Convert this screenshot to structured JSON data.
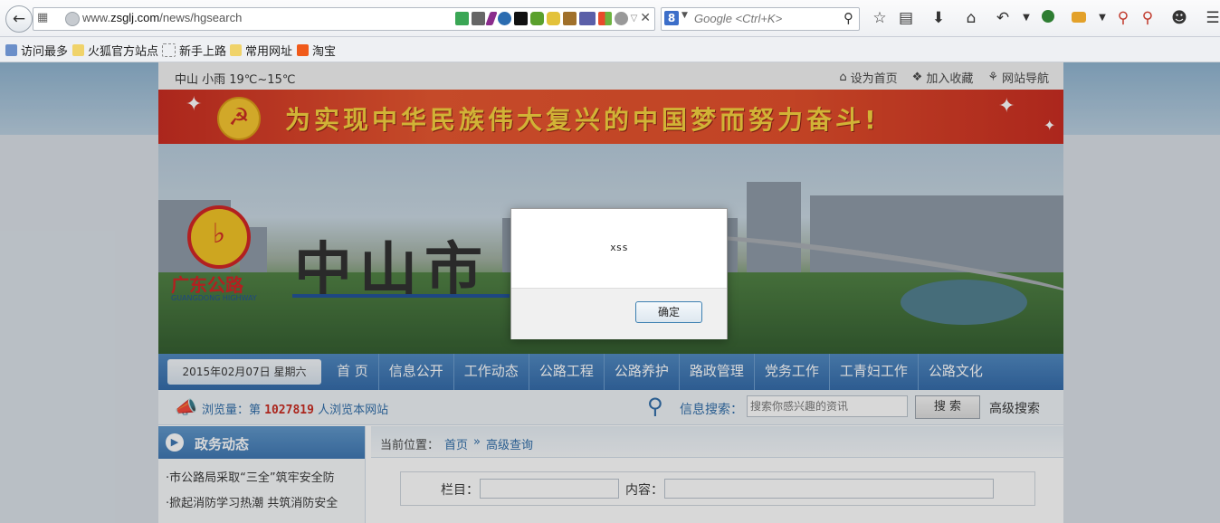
{
  "browser": {
    "url_prefix": "www.",
    "url_domain": "zsglj.com",
    "url_path": "/news/hgsearch",
    "search_engine_glyph": "8",
    "search_placeholder": "Google <Ctrl+K>",
    "url_icons": [
      "shield-check-icon",
      "qr-icon",
      "pen-icon",
      "moon-icon",
      "square-icon",
      "lock-icon",
      "lock-icon",
      "camel-icon",
      "php-icon",
      "windows-icon",
      "gear-icon",
      "dropdown-icon",
      "close-icon"
    ],
    "toolbar_icons": [
      "star-icon",
      "reader-icon",
      "download-icon",
      "home-icon",
      "undo-icon",
      "dropdown-icon",
      "green-ball-icon",
      "bug-icon",
      "dropdown-icon",
      "zoom-in-icon",
      "zoom-out-icon",
      "smile-icon",
      "menu-icon"
    ]
  },
  "bookmarks": [
    {
      "label": "访问最多"
    },
    {
      "label": "火狐官方站点"
    },
    {
      "label": "新手上路"
    },
    {
      "label": "常用网址"
    },
    {
      "label": "淘宝"
    }
  ],
  "site": {
    "weather": "中山  小雨  19℃~15℃",
    "top_links": [
      "设为首页",
      "加入收藏",
      "网站导航"
    ],
    "slogan": "为实现中华民族伟大复兴的中国梦而努力奋斗!",
    "logo_text": "广东公路",
    "logo_sub": "GUANGDONG HIGHWAY",
    "city_title": "中山市",
    "date": "2015年02月07日 星期六",
    "nav": [
      "首 页",
      "信息公开",
      "工作动态",
      "公路工程",
      "公路养护",
      "路政管理",
      "党务工作",
      "工青妇工作",
      "公路文化"
    ],
    "pv_prefix": "浏览量：第",
    "pv_count": "1027819",
    "pv_suffix": "人浏览本网站",
    "search_label": "信息搜索：",
    "search_placeholder": "搜索你感兴趣的资讯",
    "search_button": "搜 索",
    "advanced_search": "高级搜索",
    "left_title": "政务动态",
    "news": [
      "·市公路局采取“三全”筑牢安全防",
      "·掀起消防学习热潮 共筑消防安全"
    ],
    "crumb_label": "当前位置：",
    "crumb_home": "首页",
    "crumb_sep": "»",
    "crumb_current": "高级查询",
    "form_column": "栏目：",
    "form_content": "内容："
  },
  "dialog": {
    "message": "xss",
    "ok": "确定"
  }
}
